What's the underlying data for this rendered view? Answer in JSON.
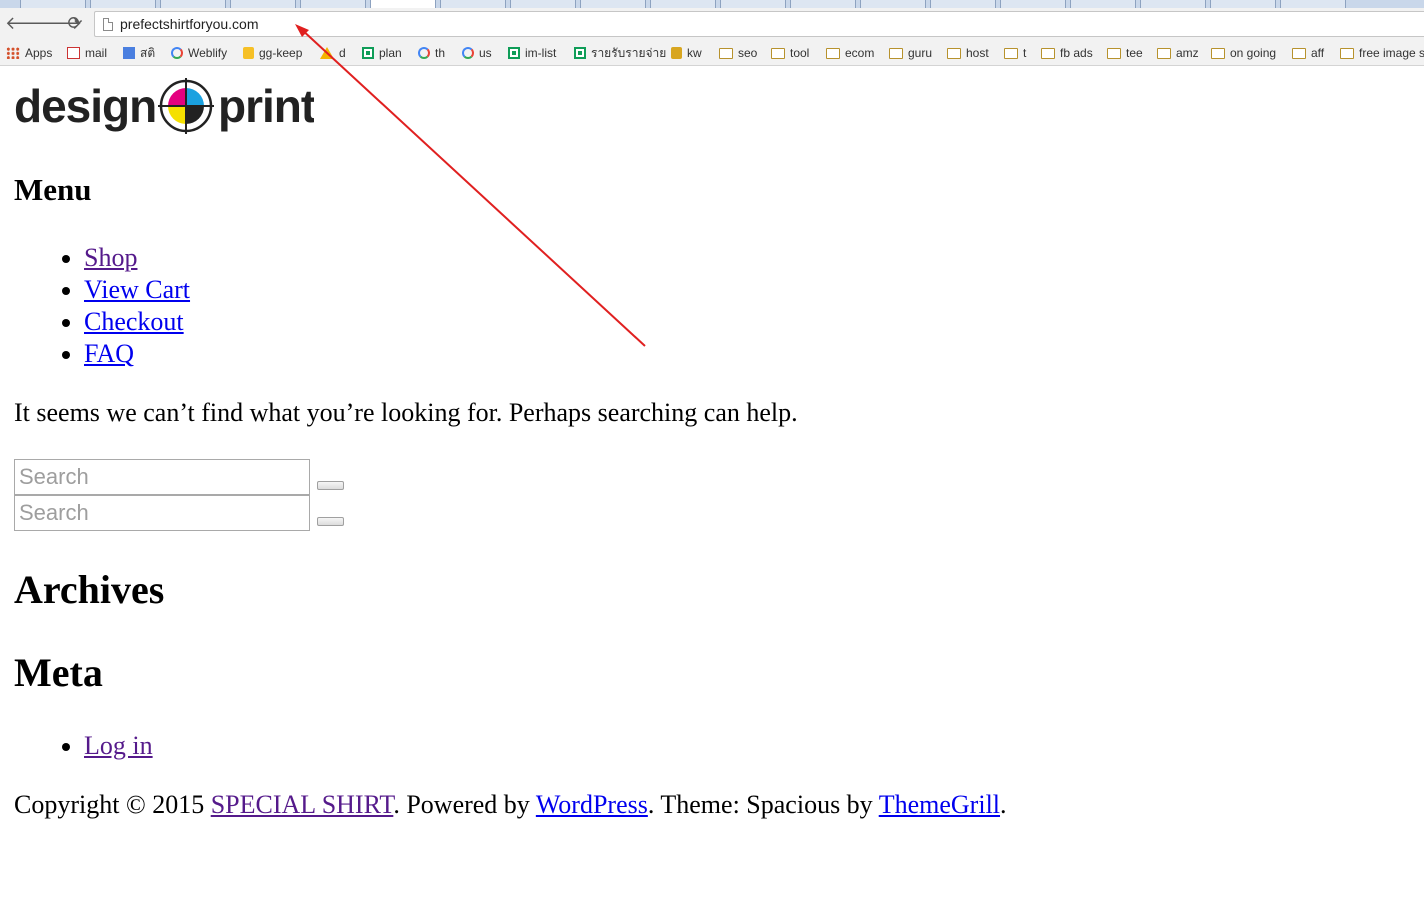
{
  "browser": {
    "url": "prefectshirtforyou.com",
    "back_glyph": "🡐",
    "forward_glyph": "🡒",
    "reload_glyph": "⟳",
    "bookmarks": [
      {
        "label": "Apps",
        "icon": "apps-icon"
      },
      {
        "label": "mail",
        "icon": "gmail-icon"
      },
      {
        "label": "สติ",
        "icon": "doc-icon"
      },
      {
        "label": "Weblify",
        "icon": "google-icon"
      },
      {
        "label": "gg-keep",
        "icon": "keep-icon"
      },
      {
        "label": "d",
        "icon": "drive-icon"
      },
      {
        "label": "plan",
        "icon": "sheet-icon"
      },
      {
        "label": "th",
        "icon": "google-icon"
      },
      {
        "label": "us",
        "icon": "google-icon"
      },
      {
        "label": "im-list",
        "icon": "sheet-icon"
      },
      {
        "label": "รายรับรายจ่าย",
        "icon": "sheet-icon"
      },
      {
        "label": "kw",
        "icon": "lock-icon"
      },
      {
        "label": "seo",
        "icon": "folder-icon"
      },
      {
        "label": "tool",
        "icon": "folder-icon"
      },
      {
        "label": "ecom",
        "icon": "folder-icon"
      },
      {
        "label": "guru",
        "icon": "folder-icon"
      },
      {
        "label": "host",
        "icon": "folder-icon"
      },
      {
        "label": "t",
        "icon": "folder-icon"
      },
      {
        "label": "fb ads",
        "icon": "folder-icon"
      },
      {
        "label": "tee",
        "icon": "folder-icon"
      },
      {
        "label": "amz",
        "icon": "folder-icon"
      },
      {
        "label": "on going",
        "icon": "folder-icon"
      },
      {
        "label": "aff",
        "icon": "folder-icon"
      },
      {
        "label": "free image s",
        "icon": "folder-icon"
      }
    ]
  },
  "logo": {
    "left_word": "design",
    "right_word": "print"
  },
  "menu": {
    "title": "Menu",
    "items": [
      "Shop",
      "View Cart",
      "Checkout",
      "FAQ"
    ]
  },
  "notice": "It seems we can’t find what you’re looking for. Perhaps searching can help.",
  "search": {
    "placeholder": "Search",
    "value": ""
  },
  "widgets": {
    "archives_title": "Archives",
    "meta_title": "Meta",
    "meta_links": [
      "Log in"
    ]
  },
  "footer": {
    "prefix": "Copyright © 2015 ",
    "site_link": "SPECIAL SHIRT",
    "powered": ". Powered by ",
    "wp_link": "WordPress",
    "theme": ". Theme: Spacious by ",
    "themegrill_link": "ThemeGrill",
    "suffix": "."
  },
  "colors": {
    "link": "#0000ee",
    "visited": "#551a8b",
    "annotation_arrow": "#e02020"
  }
}
